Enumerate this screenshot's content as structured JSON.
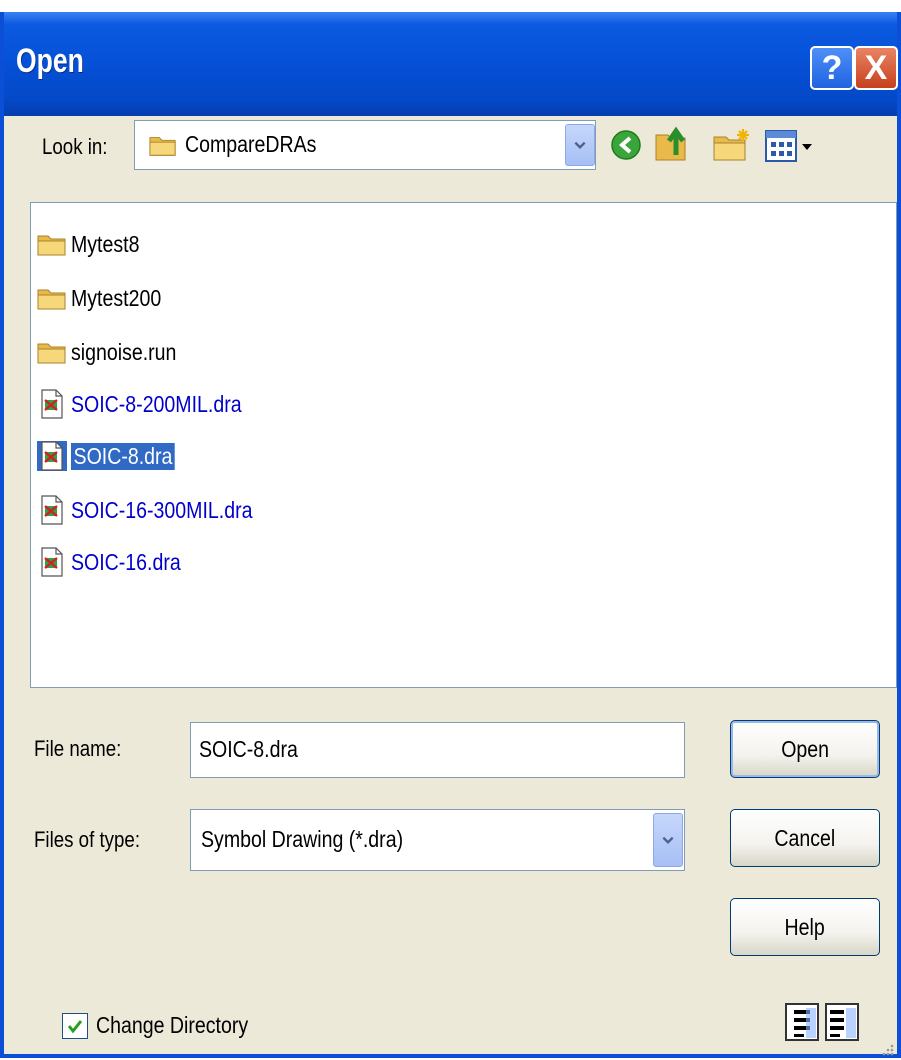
{
  "window": {
    "title": "Open",
    "help_glyph": "?",
    "close_glyph": "X"
  },
  "lookin": {
    "label": "Look in:",
    "value": "CompareDRAs",
    "icon": "folder-icon"
  },
  "toolbar": {
    "back_icon": "back-arrow-icon",
    "up_icon": "up-folder-icon",
    "new_folder_icon": "new-folder-icon",
    "views_icon": "views-menu-icon"
  },
  "files": [
    {
      "name": "Mytest8",
      "type": "folder"
    },
    {
      "name": "Mytest200",
      "type": "folder"
    },
    {
      "name": "signoise.run",
      "type": "folder"
    },
    {
      "name": "SOIC-8-200MIL.dra",
      "type": "dra"
    },
    {
      "name": "SOIC-8.dra",
      "type": "dra",
      "selected": true
    },
    {
      "name": "SOIC-16-300MIL.dra",
      "type": "dra"
    },
    {
      "name": "SOIC-16.dra",
      "type": "dra"
    }
  ],
  "filename": {
    "label": "File name:",
    "value": "SOIC-8.dra"
  },
  "filetype": {
    "label": "Files of type:",
    "value": "Symbol Drawing (*.dra)"
  },
  "buttons": {
    "open": "Open",
    "cancel": "Cancel",
    "help": "Help"
  },
  "change_dir": {
    "label": "Change Directory",
    "checked": true
  },
  "colors": {
    "title_bar": "#0550d6",
    "selection": "#316ac5",
    "file_link": "#0000cc",
    "dialog_bg": "#ece9d8"
  }
}
